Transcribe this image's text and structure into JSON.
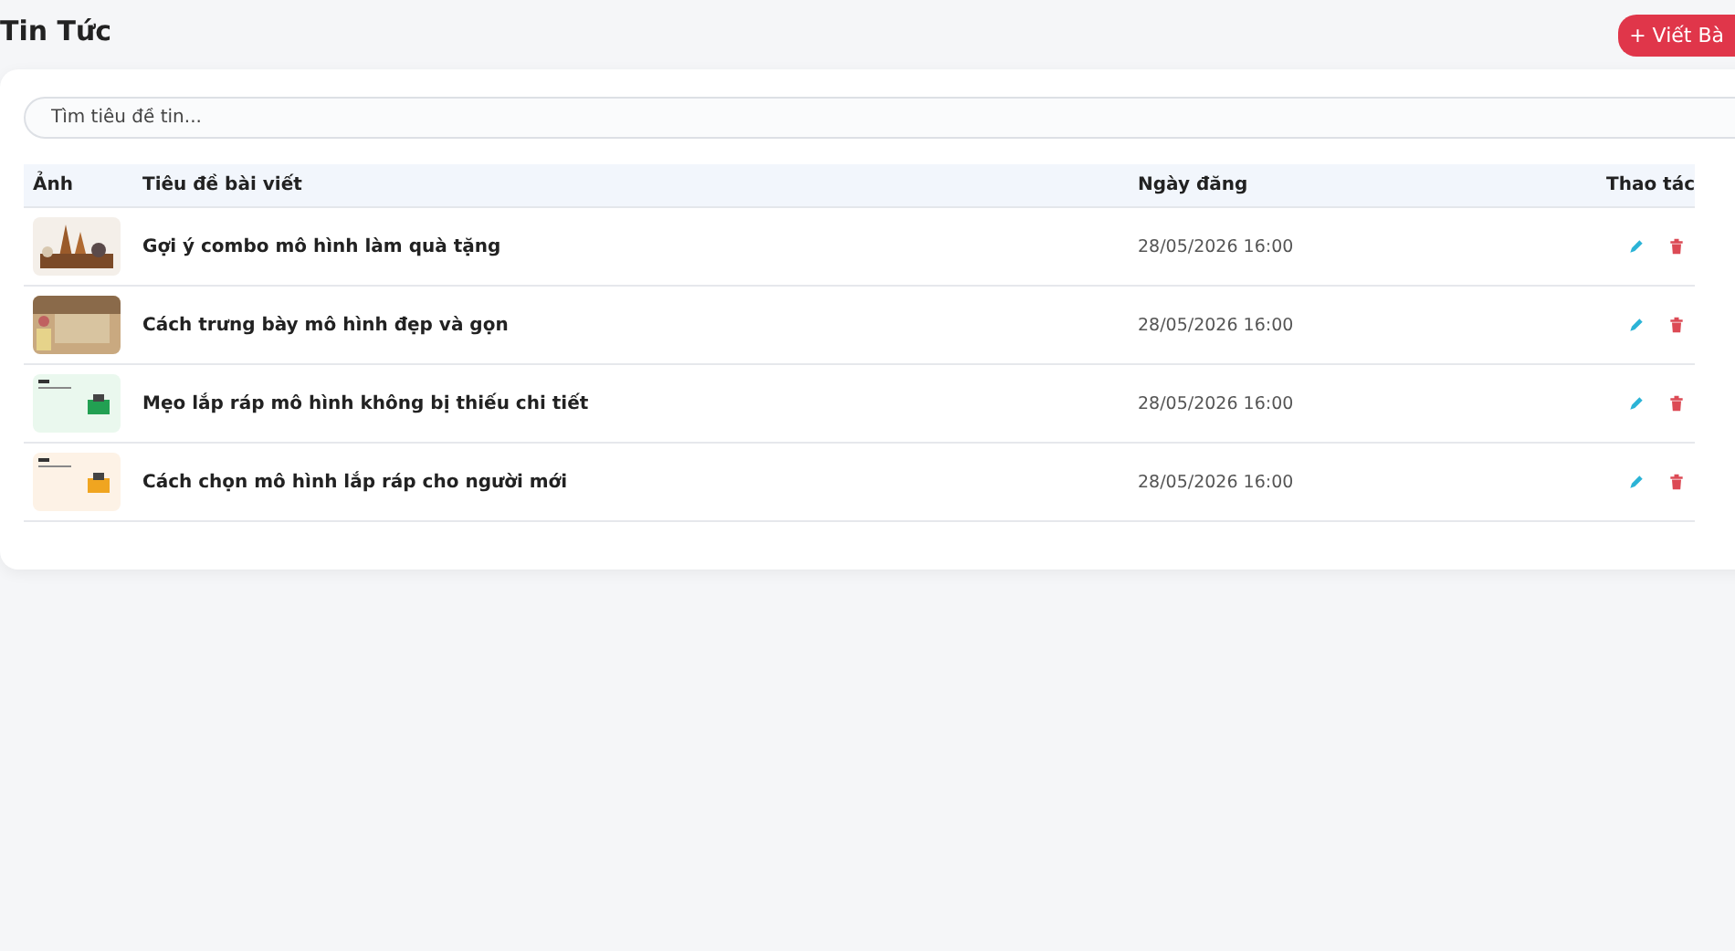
{
  "page_title": "Tin Tức",
  "add_button": "+ Viết Bà",
  "search": {
    "placeholder": "Tìm tiêu đề tin..."
  },
  "table": {
    "columns": [
      "Ảnh",
      "Tiêu đề bài viết",
      "Ngày đăng",
      "Thao tác"
    ],
    "rows": [
      {
        "title": "Gợi ý combo mô hình làm quà tặng",
        "date": "28/05/2026 16:00"
      },
      {
        "title": "Cách trưng bày mô hình đẹp và gọn",
        "date": "28/05/2026 16:00"
      },
      {
        "title": "Mẹo lắp ráp mô hình không bị thiếu chi tiết",
        "date": "28/05/2026 16:00"
      },
      {
        "title": "Cách chọn mô hình lắp ráp cho người mới",
        "date": "28/05/2026 16:00"
      }
    ]
  }
}
